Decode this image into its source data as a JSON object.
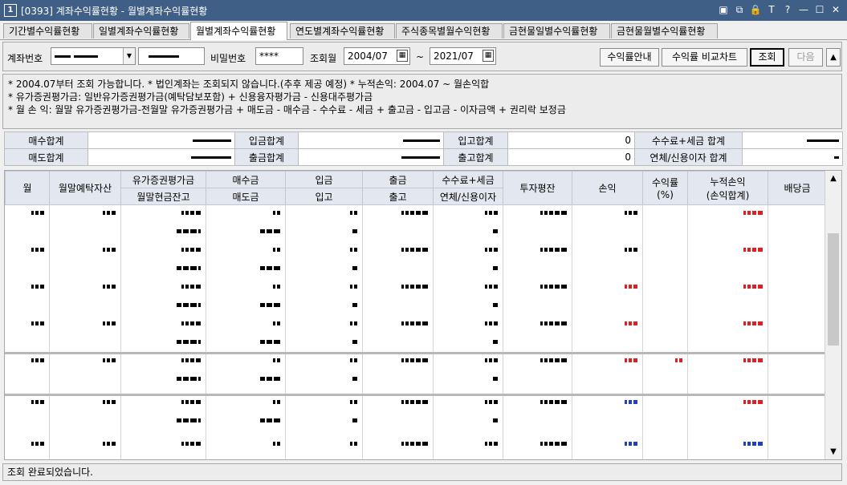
{
  "window": {
    "icon_label": "1",
    "title": "[0393] 계좌수익률현황 - 월별계좌수익률현황",
    "controls": [
      "▣",
      "⧉",
      "🔒",
      "T",
      "?",
      "—",
      "☐",
      "✕"
    ]
  },
  "tabs": [
    {
      "label": "기간별수익률현황",
      "active": false
    },
    {
      "label": "일별계좌수익률현황",
      "active": false
    },
    {
      "label": "월별계좌수익률현황",
      "active": true
    },
    {
      "label": "연도별계좌수익률현황",
      "active": false
    },
    {
      "label": "주식종목별월수익현황",
      "active": false
    },
    {
      "label": "금현물일별수익률현황",
      "active": false
    },
    {
      "label": "금현물월별수익률현황",
      "active": false
    }
  ],
  "search": {
    "account_label": "계좌번호",
    "password_label": "비밀번호",
    "password_value": "****",
    "period_label": "조회월",
    "from_month": "2004/07",
    "tilde": "~",
    "to_month": "2021/07",
    "btn_guide": "수익률안내",
    "btn_compare": "수익률 비교차트",
    "btn_query": "조회",
    "btn_next": "다음",
    "btn_up": "▲",
    "dropdown_arrow": "▼",
    "calendar_glyph": "▦"
  },
  "notes": {
    "line1": "* 2004.07부터 조회 가능합니다.   * 법인계좌는 조회되지 않습니다.(추후 제공 예정)   * 누적손익: 2004.07 ~ 월손익합",
    "line2": "* 유가증권평가금: 일반유가증권평가금(예탁담보포함) + 신용융자평가금 - 신용대주평가금",
    "line3": "* 월 손 익: 월말 유가증권평가금-전월말 유가증권평가금 + 매도금 - 매수금 - 수수료 - 세금 + 출고금 - 입고금 - 이자금액 + 권리락 보정금"
  },
  "summary": {
    "buy_total": "매수합계",
    "sell_total": "매도합계",
    "deposit_total": "입금합계",
    "withdraw_total": "출금합계",
    "in_total": "입고합계",
    "in_total_value": "0",
    "out_total": "출고합계",
    "out_total_value": "0",
    "fee_tax_total": "수수료+세금 합계",
    "interest_total": "연체/신용이자 합계"
  },
  "grid": {
    "headers": {
      "month": "월",
      "eom_deposit": "월말예탁자산",
      "securities_eval": "유가증권평가금",
      "eom_cash": "월말현금잔고",
      "buy_amount": "매수금",
      "sell_amount": "매도금",
      "deposit": "입금",
      "stock_in": "입고",
      "withdraw": "출금",
      "stock_out": "출고",
      "fee_tax": "수수료+세금",
      "interest": "연체/신용이자",
      "avg_invest": "투자평잔",
      "profit": "손익",
      "return_rate": "수익률",
      "return_rate_unit": "(%)",
      "cum_profit": "누적손익",
      "cum_profit_sub": "(손익합계)",
      "dividend": "배당금"
    }
  },
  "status": {
    "message": "조회 완료되었습니다."
  }
}
